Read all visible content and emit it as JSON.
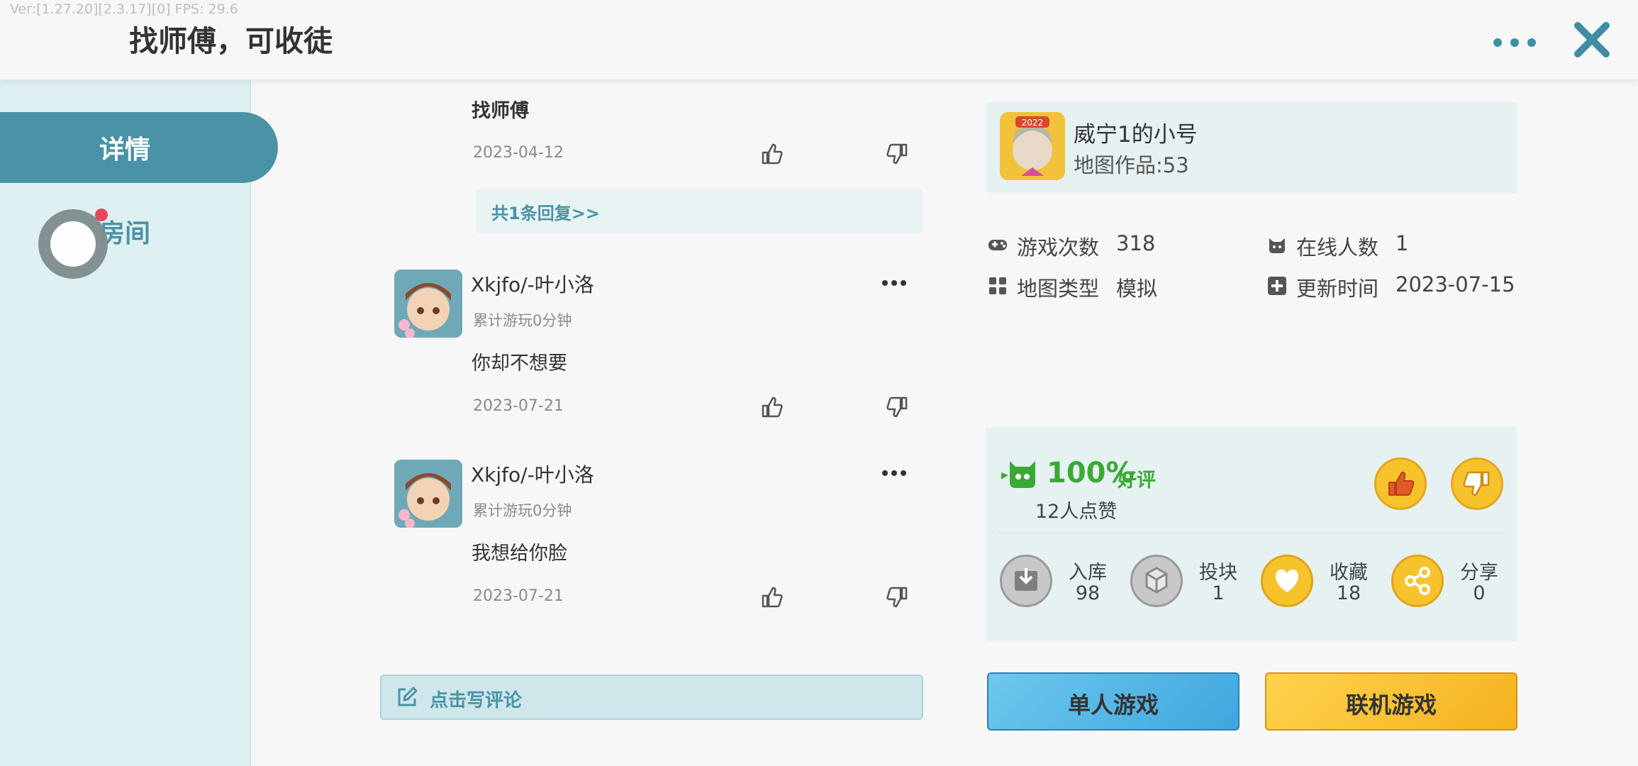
{
  "debug": {
    "version": "Ver:[1.27.20][2.3.17][0] FPS: 29.6"
  },
  "header": {
    "title": "找师傅，可收徒",
    "more_icon": "more-dots-icon",
    "close_icon": "close-icon"
  },
  "sidebar": {
    "tabs": [
      {
        "label": "详情",
        "active": true
      },
      {
        "label": "房间",
        "active": false,
        "has_badge": true
      }
    ]
  },
  "comments": {
    "first": {
      "text": "找师傅",
      "date": "2023-04-12",
      "reply_link": "共1条回复>>"
    },
    "items": [
      {
        "user": "Xkjfo/-叶小洛",
        "playtime": "累计游玩0分钟",
        "text": "你却不想要",
        "date": "2023-07-21"
      },
      {
        "user": "Xkjfo/-叶小洛",
        "playtime": "累计游玩0分钟",
        "text": "我想给你脸",
        "date": "2023-07-21"
      }
    ],
    "write_label": "点击写评论"
  },
  "author": {
    "name": "威宁1的小号",
    "works": "地图作品:53",
    "badge_year": "2022"
  },
  "stats": {
    "plays_label": "游戏次数",
    "plays_value": "318",
    "online_label": "在线人数",
    "online_value": "1",
    "type_label": "地图类型",
    "type_value": "模拟",
    "updated_label": "更新时间",
    "updated_value": "2023-07-15"
  },
  "rating": {
    "percent": "100%",
    "percent_label": "好评",
    "likes": "12人点赞"
  },
  "actions": [
    {
      "label": "入库",
      "count": "98",
      "icon": "download-icon"
    },
    {
      "label": "投块",
      "count": "1",
      "icon": "block-icon"
    },
    {
      "label": "收藏",
      "count": "18",
      "icon": "heart-icon"
    },
    {
      "label": "分享",
      "count": "0",
      "icon": "share-icon"
    }
  ],
  "buttons": {
    "single": "单人游戏",
    "multi": "联机游戏"
  },
  "colors": {
    "accent": "#4a93a6",
    "green": "#3aaa35",
    "yellow": "#f7c32d",
    "blue": "#3fa7de"
  }
}
